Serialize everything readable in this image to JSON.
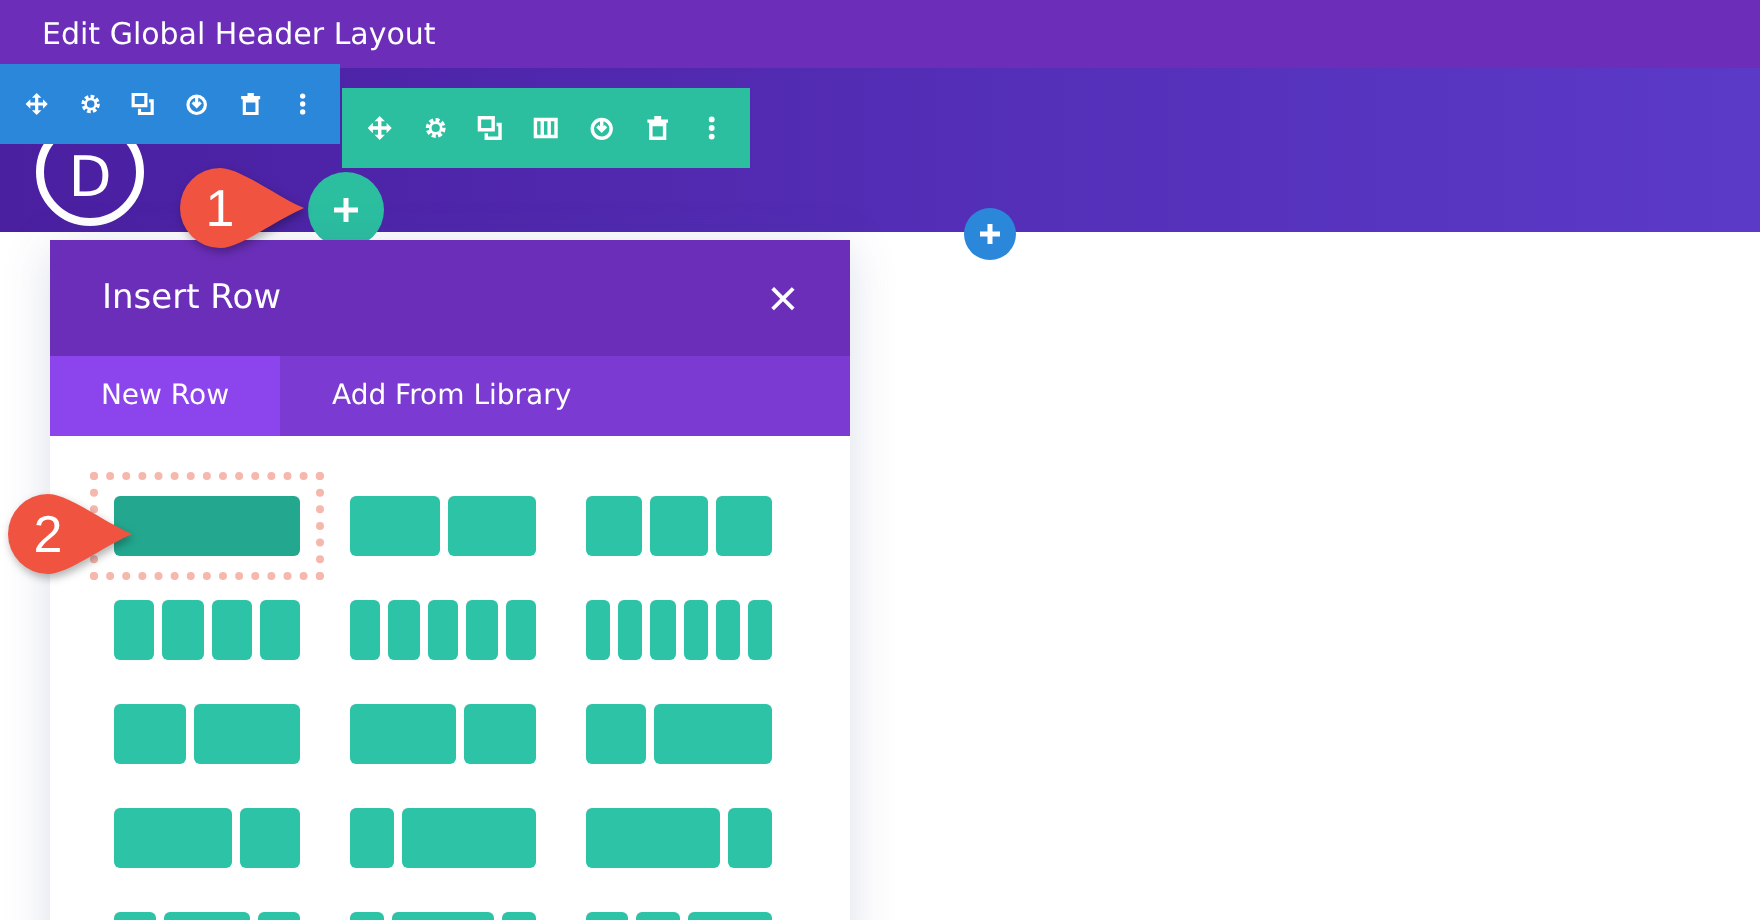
{
  "window": {
    "title": "Edit Global Header Layout"
  },
  "logo": "D",
  "callouts": [
    "1",
    "2"
  ],
  "dialog": {
    "title": "Insert Row",
    "close": "×"
  },
  "tabs": [
    {
      "label": "New Row",
      "selected": true
    },
    {
      "label": "Add From Library",
      "selected": false
    }
  ],
  "layouts": [
    {
      "selected": true
    },
    {
      "selected": false
    },
    {
      "selected": false
    },
    {
      "selected": false
    },
    {
      "selected": false
    },
    {
      "selected": false
    },
    {
      "selected": false
    },
    {
      "selected": false
    },
    {
      "selected": false
    },
    {
      "selected": false
    },
    {
      "selected": false
    },
    {
      "selected": false
    },
    {
      "selected": false
    },
    {
      "selected": false
    },
    {
      "selected": false
    }
  ]
}
